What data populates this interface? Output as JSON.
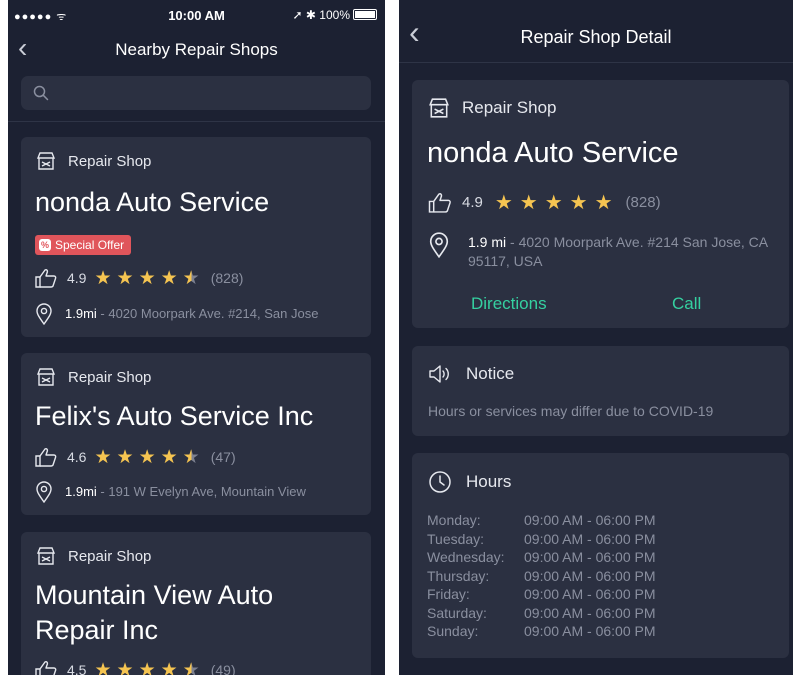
{
  "status_bar": {
    "signal": "●●●●● ᯤ",
    "time": "10:00 AM",
    "right": "➚ ✱ 100%"
  },
  "list_screen": {
    "title": "Nearby Repair Shops",
    "back_glyph": "‹",
    "search": {
      "value": "",
      "placeholder": ""
    },
    "shops": [
      {
        "type": "Repair Shop",
        "name": "nonda Auto Service",
        "badge": "Special Offer",
        "rating": 4.9,
        "rating_text": "4.9",
        "stars": 4.5,
        "reviews": "(828)",
        "distance": "1.9mi",
        "address": " - 4020 Moorpark Ave. #214, San Jose"
      },
      {
        "type": "Repair Shop",
        "name": "Felix's Auto Service Inc",
        "rating": 4.6,
        "rating_text": "4.6",
        "stars": 4.5,
        "reviews": "(47)",
        "distance": "1.9mi",
        "address": " - 191 W Evelyn Ave, Mountain View"
      },
      {
        "type": "Repair Shop",
        "name": "Mountain View Auto Repair Inc",
        "rating": 4.5,
        "rating_text": "4.5",
        "stars": 4.5,
        "reviews": "(49)"
      }
    ]
  },
  "detail_screen": {
    "title": "Repair Shop Detail",
    "back_glyph": "‹",
    "shop": {
      "type": "Repair Shop",
      "name": "nonda Auto Service",
      "rating_text": "4.9",
      "stars": 5,
      "reviews": "(828)",
      "distance": "1.9 mi",
      "address": " - 4020 Moorpark Ave. #214 San Jose, CA 95117, USA"
    },
    "actions": {
      "directions": "Directions",
      "call": "Call"
    },
    "notice": {
      "heading": "Notice",
      "text": "Hours or services may differ due to COVID-19"
    },
    "hours": {
      "heading": "Hours",
      "rows": [
        {
          "day": "Monday:",
          "time": "09:00 AM - 06:00 PM"
        },
        {
          "day": "Tuesday:",
          "time": "09:00 AM - 06:00 PM"
        },
        {
          "day": "Wednesday:",
          "time": "09:00 AM - 06:00 PM"
        },
        {
          "day": "Thursday:",
          "time": "09:00 AM - 06:00 PM"
        },
        {
          "day": "Friday:",
          "time": "09:00 AM - 06:00 PM"
        },
        {
          "day": "Saturday:",
          "time": "09:00 AM - 06:00 PM"
        },
        {
          "day": "Sunday:",
          "time": "09:00 AM - 06:00 PM"
        }
      ]
    }
  },
  "colors": {
    "background": "#1c2132",
    "card": "#2b3041",
    "accent_green": "#35d0a0",
    "star": "#f5c451",
    "badge": "#e0555b",
    "muted_text": "#8a8f9f"
  },
  "icons": [
    "shop-icon",
    "thumbs-up-icon",
    "location-pin-icon",
    "speaker-icon",
    "clock-icon",
    "search-icon",
    "back-chevron-icon",
    "star-icon"
  ]
}
